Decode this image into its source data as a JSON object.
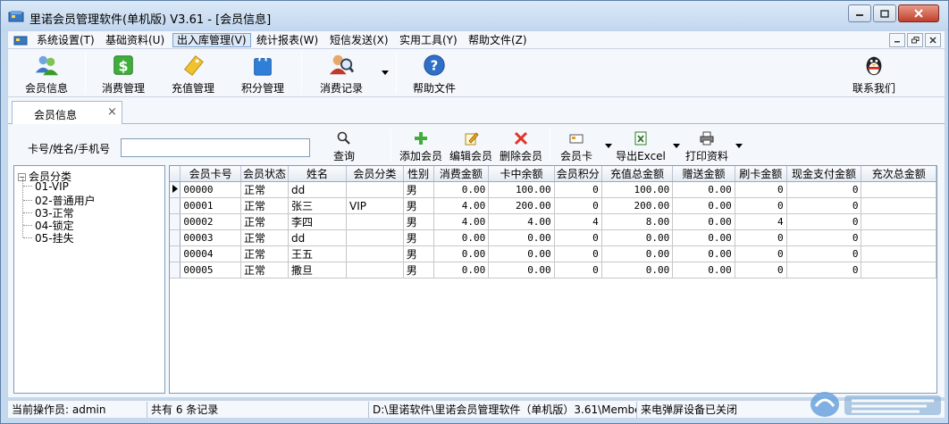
{
  "window": {
    "title": "里诺会员管理软件(单机版) V3.61 - [会员信息]"
  },
  "menu": {
    "items": [
      {
        "label": "系统设置(T)"
      },
      {
        "label": "基础资料(U)"
      },
      {
        "label": "出入库管理(V)",
        "active": true
      },
      {
        "label": "统计报表(W)"
      },
      {
        "label": "短信发送(X)"
      },
      {
        "label": "实用工具(Y)"
      },
      {
        "label": "帮助文件(Z)"
      }
    ]
  },
  "toolbar": {
    "buttons": [
      {
        "label": "会员信息",
        "icon": "members-icon"
      },
      {
        "label": "消费管理",
        "icon": "dollar-icon"
      },
      {
        "label": "充值管理",
        "icon": "tag-icon"
      },
      {
        "label": "积分管理",
        "icon": "bag-icon"
      },
      {
        "label": "消费记录",
        "icon": "search-person-icon"
      },
      {
        "label": "帮助文件",
        "icon": "help-icon"
      },
      {
        "label": "联系我们",
        "icon": "qq-penguin-icon"
      }
    ]
  },
  "tab": {
    "label": "会员信息",
    "close": "×"
  },
  "search": {
    "label": "卡号/姓名/手机号",
    "value": "",
    "query_label": "查询"
  },
  "actions": {
    "add": "添加会员",
    "edit": "编辑会员",
    "delete": "删除会员",
    "card": "会员卡",
    "export": "导出Excel",
    "print": "打印资料"
  },
  "tree": {
    "root": "会员分类",
    "items": [
      "01-VIP",
      "02-普通用户",
      "03-正常",
      "04-锁定",
      "05-挂失"
    ]
  },
  "grid": {
    "columns": [
      "会员卡号",
      "会员状态",
      "姓名",
      "会员分类",
      "性别",
      "消费金额",
      "卡中余额",
      "会员积分",
      "充值总金额",
      "赠送金额",
      "刷卡金额",
      "现金支付金额",
      "充次总金额"
    ],
    "rows": [
      [
        "00000",
        "正常",
        "dd",
        "",
        "男",
        "0.00",
        "100.00",
        "0",
        "100.00",
        "0.00",
        "0",
        "0",
        ""
      ],
      [
        "00001",
        "正常",
        "张三",
        "VIP",
        "男",
        "4.00",
        "200.00",
        "0",
        "200.00",
        "0.00",
        "0",
        "0",
        ""
      ],
      [
        "00002",
        "正常",
        "李四",
        "",
        "男",
        "4.00",
        "4.00",
        "4",
        "8.00",
        "0.00",
        "4",
        "0",
        ""
      ],
      [
        "00003",
        "正常",
        "dd",
        "",
        "男",
        "0.00",
        "0.00",
        "0",
        "0.00",
        "0.00",
        "0",
        "0",
        ""
      ],
      [
        "00004",
        "正常",
        "王五",
        "",
        "男",
        "0.00",
        "0.00",
        "0",
        "0.00",
        "0.00",
        "0",
        "0",
        ""
      ],
      [
        "00005",
        "正常",
        "撒旦",
        "",
        "男",
        "0.00",
        "0.00",
        "0",
        "0.00",
        "0.00",
        "0",
        "0",
        ""
      ]
    ]
  },
  "status": {
    "operator": "当前操作员: admin",
    "count": "共有 6 条记录",
    "path": "D:\\里诺软件\\里诺会员管理软件（单机版）3.61\\Membe",
    "device": "来电弹屏设备已关闭"
  },
  "colors": {
    "frame": "#c4d8ee",
    "panel": "#f4f7fb",
    "border": "#7f9db9"
  }
}
